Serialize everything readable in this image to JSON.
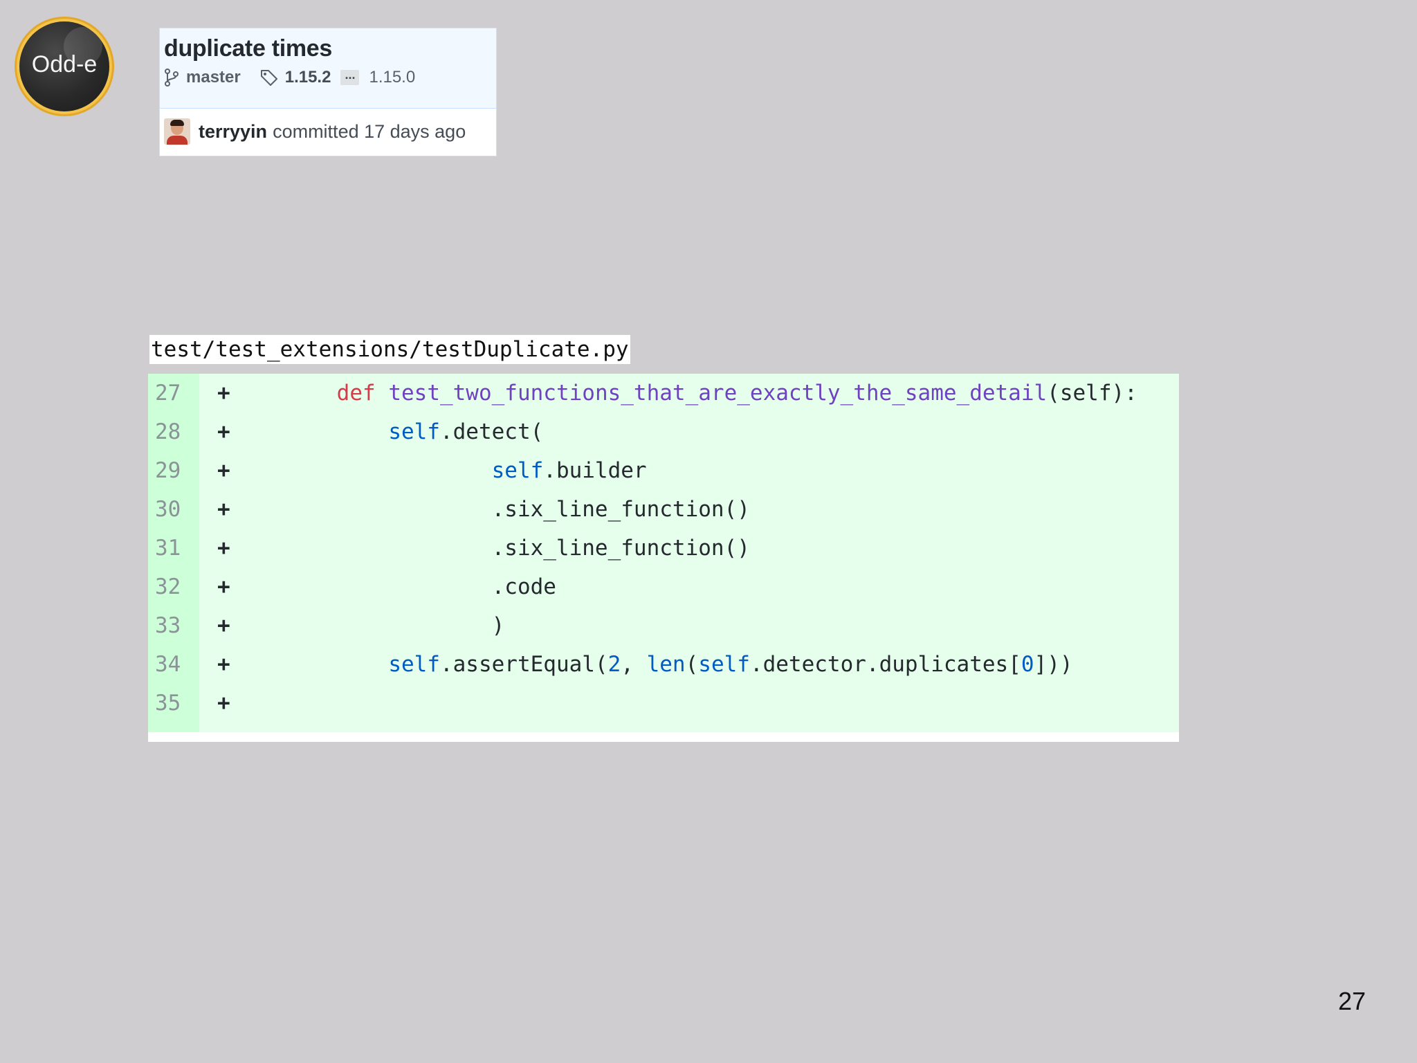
{
  "logo": {
    "text": "Odd-e"
  },
  "commit": {
    "title": "duplicate times",
    "branch": "master",
    "tag_current": "1.15.2",
    "ellipsis": "...",
    "tag_old": "1.15.0",
    "author": "terryyin",
    "committed_text": "committed 17 days ago"
  },
  "file": {
    "path": "test/test_extensions/testDuplicate.py"
  },
  "diff": {
    "lines": [
      {
        "num": "27",
        "marker": "+"
      },
      {
        "num": "28",
        "marker": "+"
      },
      {
        "num": "29",
        "marker": "+"
      },
      {
        "num": "30",
        "marker": "+"
      },
      {
        "num": "31",
        "marker": "+"
      },
      {
        "num": "32",
        "marker": "+"
      },
      {
        "num": "33",
        "marker": "+"
      },
      {
        "num": "34",
        "marker": "+"
      },
      {
        "num": "35",
        "marker": "+"
      }
    ],
    "code": {
      "l27_indent": "    ",
      "l27_def": "def",
      "l27_fn": "test_two_functions_that_are_exactly_the_same_detail",
      "l27_rest": "(self):",
      "l28_indent": "        ",
      "l28_self": "self",
      "l28_rest": ".detect(",
      "l29_indent": "                ",
      "l29_self": "self",
      "l29_rest": ".builder",
      "l30": "                .six_line_function()",
      "l31": "                .six_line_function()",
      "l32": "                .code",
      "l33": "                )",
      "l34_indent": "        ",
      "l34_self": "self",
      "l34_a": ".assertEqual(",
      "l34_num": "2",
      "l34_b": ", ",
      "l34_len": "len",
      "l34_c": "(",
      "l34_self2": "self",
      "l34_d": ".detector.duplicates[",
      "l34_zero": "0",
      "l34_e": "]))",
      "l35": ""
    }
  },
  "page": {
    "number": "27"
  }
}
